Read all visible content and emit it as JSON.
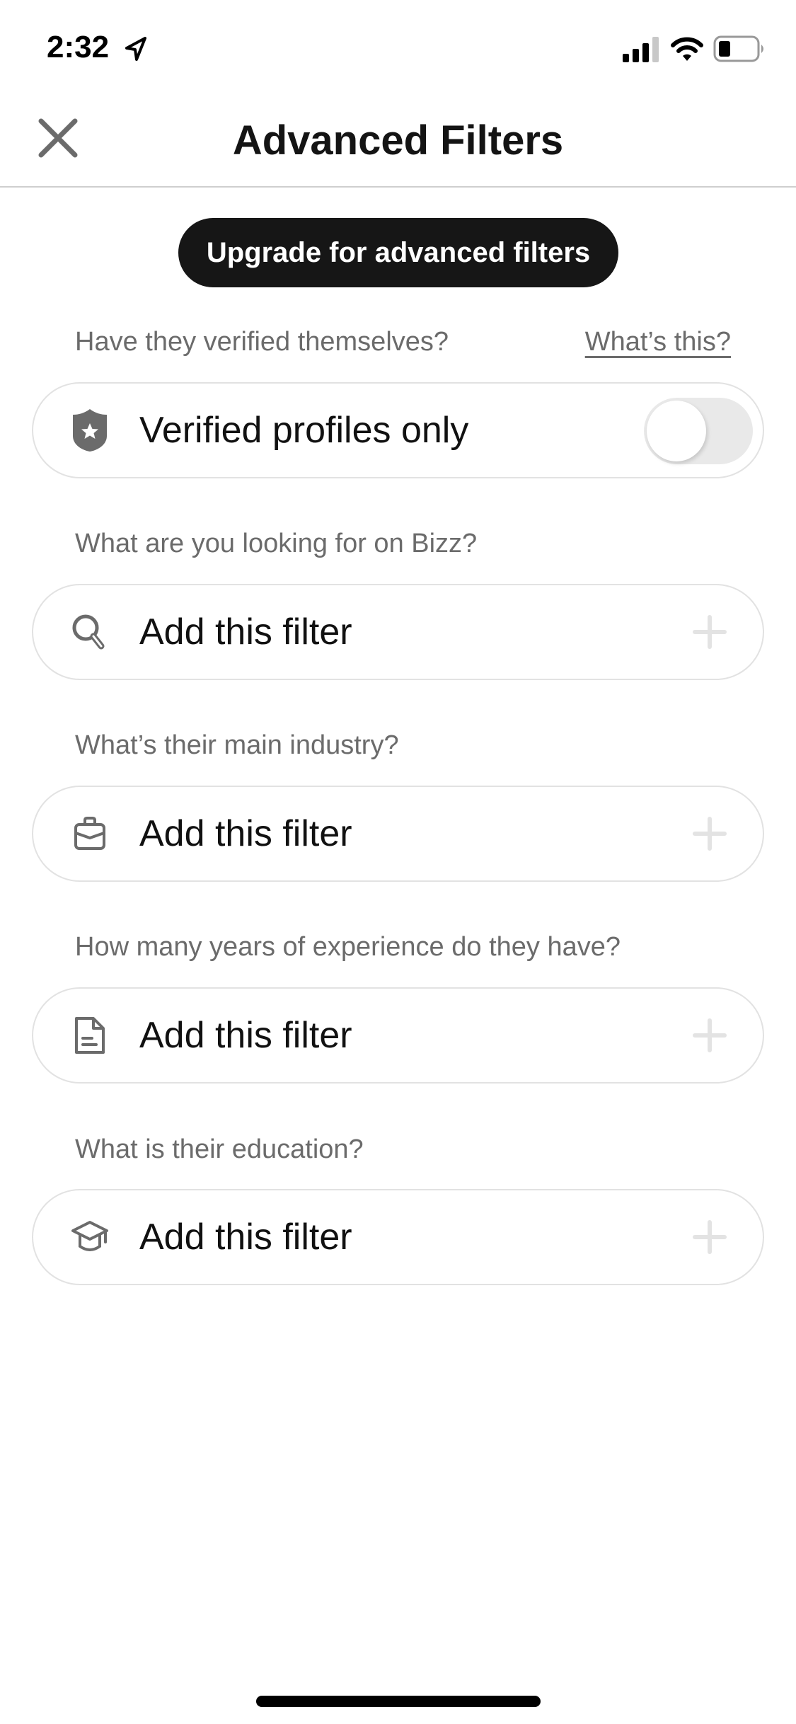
{
  "status_bar": {
    "time": "2:32",
    "icons": [
      "location-arrow-icon",
      "cellular-signal-icon",
      "wifi-icon",
      "battery-icon"
    ],
    "battery_level": 0.3
  },
  "nav": {
    "title": "Advanced Filters",
    "close_icon": "close-icon"
  },
  "upgrade_button": {
    "label": "Upgrade for advanced filters"
  },
  "sections": [
    {
      "question": "Have they verified themselves?",
      "help_link": "What’s this?",
      "control": "toggle",
      "icon": "shield-star-icon",
      "label": "Verified profiles only",
      "toggle_on": false
    },
    {
      "question": "What are you looking for on Bizz?",
      "control": "add-filter",
      "icon": "search-icon",
      "label": "Add this filter"
    },
    {
      "question": "What’s their main industry?",
      "control": "add-filter",
      "icon": "briefcase-icon",
      "label": "Add this filter"
    },
    {
      "question": "How many years of experience do they have?",
      "control": "add-filter",
      "icon": "document-icon",
      "label": "Add this filter"
    },
    {
      "question": "What is their education?",
      "control": "add-filter",
      "icon": "graduation-cap-icon",
      "label": "Add this filter"
    }
  ],
  "colors": {
    "primary_text": "#111111",
    "secondary_text": "#6b6b6b",
    "button_bg": "#161616",
    "border": "#e2e2e2",
    "plus_icon": "#e3e3e3",
    "icon": "#6b6b6b"
  }
}
